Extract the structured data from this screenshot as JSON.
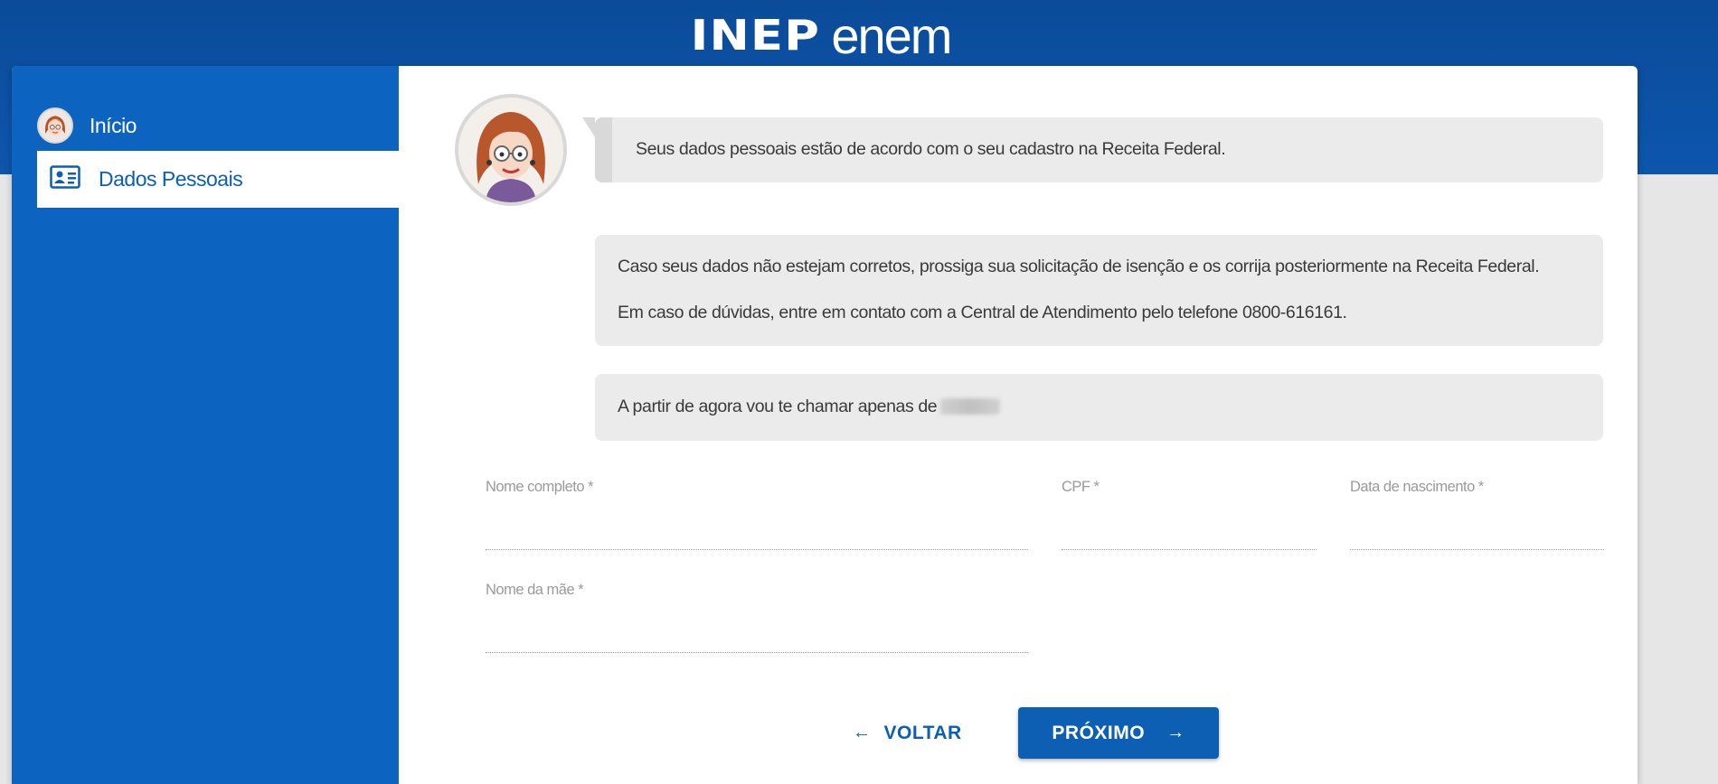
{
  "header": {
    "logo_inep": "INEP",
    "logo_enem": "enem"
  },
  "sidebar": {
    "items": [
      {
        "label": "Início",
        "icon": "avatar-icon",
        "active": false
      },
      {
        "label": "Dados Pessoais",
        "icon": "id-card-icon",
        "active": true
      }
    ]
  },
  "messages": {
    "receita_ok": "Seus dados pessoais estão de acordo com o seu cadastro na Receita Federal.",
    "correction_hint": "Caso seus dados não estejam corretos, prossiga sua solicitação de isenção e os corrija posteriormente na Receita Federal.",
    "contact_hint": "Em caso de dúvidas, entre em contato com a Central de Atendimento pelo telefone 0800-616161.",
    "nickname_prefix": "A partir de agora vou te chamar apenas de"
  },
  "form": {
    "nome_completo": {
      "label": "Nome completo *",
      "value": ""
    },
    "cpf": {
      "label": "CPF *",
      "value": ""
    },
    "data_nascimento": {
      "label": "Data de nascimento *",
      "value": ""
    },
    "nome_mae": {
      "label": "Nome da mãe *",
      "value": ""
    }
  },
  "actions": {
    "back_label": "VOLTAR",
    "next_label": "PRÓXIMO"
  },
  "colors": {
    "primary": "#0d5fb4",
    "sidebar": "#0d63c0",
    "header": "#0b4b99",
    "bubble": "#ebebeb"
  }
}
